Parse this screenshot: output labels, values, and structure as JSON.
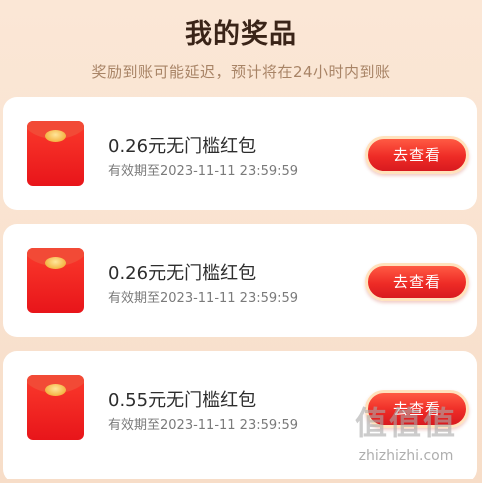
{
  "header": {
    "title": "我的奖品",
    "subtitle": "奖励到账可能延迟，预计将在24小时内到账"
  },
  "prizes": [
    {
      "name": "0.26元无门槛红包",
      "expiry": "有效期至2023-11-11 23:59:59",
      "button_label": "去查看",
      "icon": "red-envelope-icon"
    },
    {
      "name": "0.26元无门槛红包",
      "expiry": "有效期至2023-11-11 23:59:59",
      "button_label": "去查看",
      "icon": "red-envelope-icon"
    },
    {
      "name": "0.55元无门槛红包",
      "expiry": "有效期至2023-11-11 23:59:59",
      "button_label": "去查看",
      "icon": "red-envelope-icon"
    }
  ],
  "watermark": {
    "logo": "值值值",
    "text": "zhizhizhi.com"
  },
  "colors": {
    "background": "#fbe7d6",
    "button": "#ee2b26",
    "button_border": "#ffe2bd",
    "envelope": "#e8151a"
  }
}
